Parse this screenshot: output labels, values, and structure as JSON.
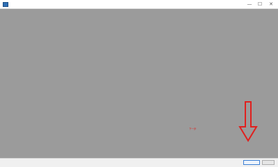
{
  "window": {
    "title": "",
    "icon": "wizard-app-icon",
    "controls": {
      "minimize": "—",
      "maximize": "☐",
      "close": "✕"
    }
  },
  "page": {
    "heading": ""
  },
  "body": {
    "paragraph_1_left": "",
    "paragraph_1_right": "",
    "paragraph_2_left": "",
    "paragraph_2_right": "",
    "link": ""
  },
  "annotation": {
    "callout_text": "下一步",
    "color": "#e0201e"
  },
  "footer": {
    "next_label": "",
    "cancel_label": ""
  },
  "colors": {
    "overlay": "#9b9b9b",
    "heading": "#2f6fb5",
    "link": "#2f5fd0"
  }
}
